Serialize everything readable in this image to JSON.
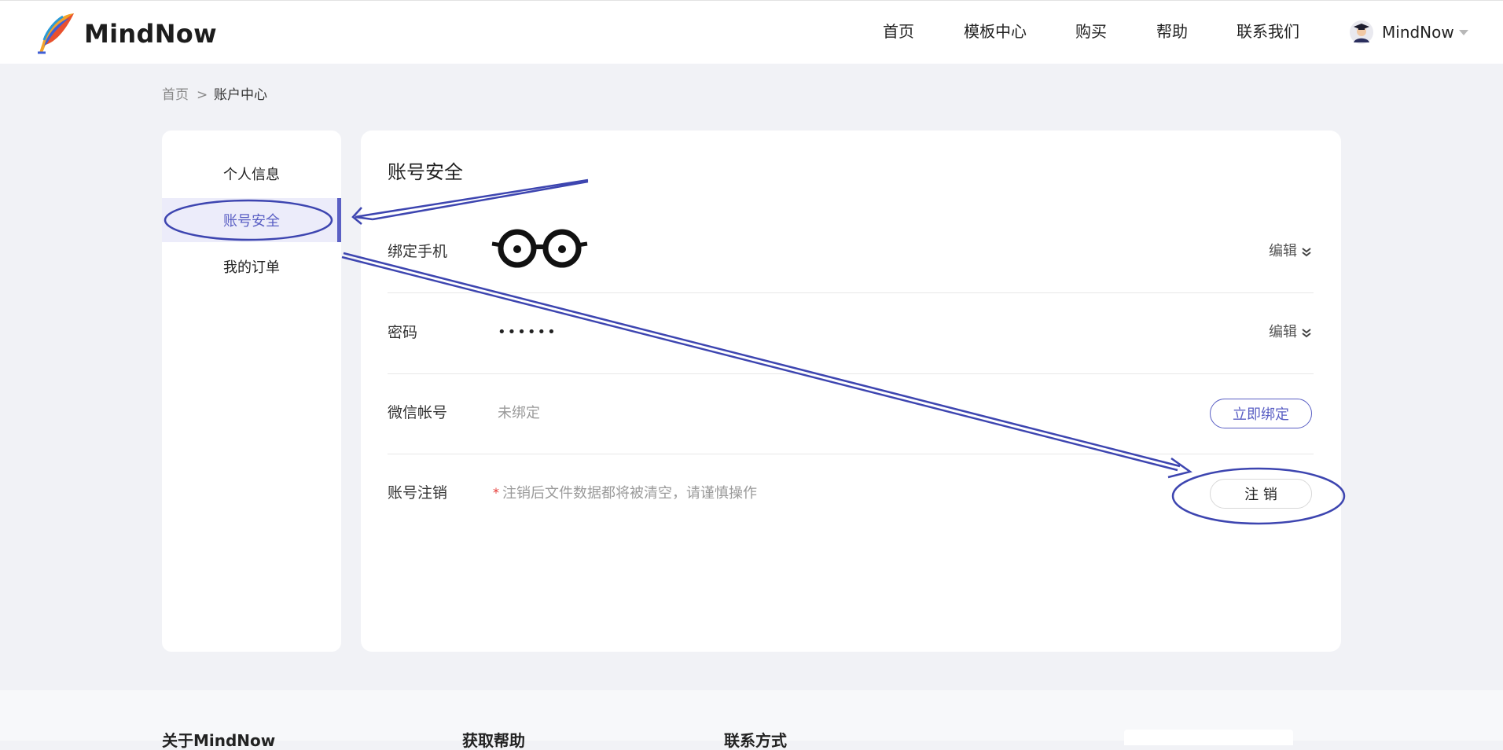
{
  "header": {
    "brand": "MindNow",
    "nav": [
      "首页",
      "模板中心",
      "购买",
      "帮助",
      "联系我们"
    ],
    "user": "MindNow"
  },
  "breadcrumb": {
    "home": "首页",
    "separator": ">",
    "current": "账户中心"
  },
  "sidebar": {
    "items": [
      {
        "label": "个人信息"
      },
      {
        "label": "账号安全"
      },
      {
        "label": "我的订单"
      }
    ]
  },
  "panel": {
    "title": "账号安全",
    "rows": {
      "phone": {
        "label": "绑定手机",
        "edit": "编辑"
      },
      "password": {
        "label": "密码",
        "value": "••••••",
        "edit": "编辑"
      },
      "wechat": {
        "label": "微信帐号",
        "value": "未绑定",
        "button": "立即绑定"
      },
      "cancel": {
        "label": "账号注销",
        "required_mark": "*",
        "hint": "注销后文件数据都将被清空，请谨慎操作",
        "button": "注 销"
      }
    }
  },
  "footer": {
    "headings": [
      "关于MindNow",
      "获取帮助",
      "联系方式"
    ]
  },
  "colors": {
    "accent": "#5a5fc4",
    "annotation": "#3d45b0",
    "danger": "#e53935"
  }
}
